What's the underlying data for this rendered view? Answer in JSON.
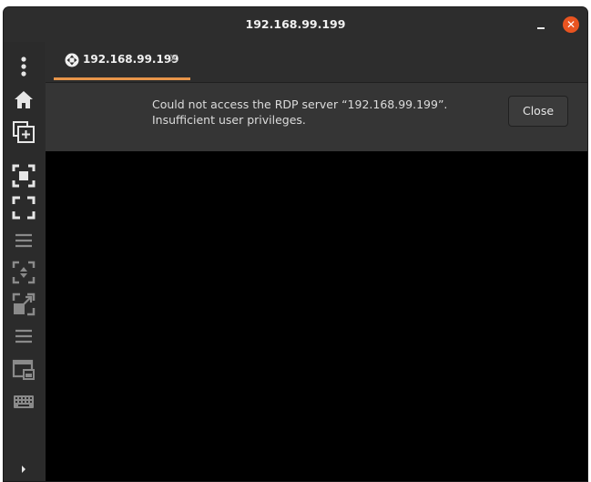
{
  "window": {
    "title": "192.168.99.199",
    "close_symbol": "✕"
  },
  "tab": {
    "label": "192.168.99.199",
    "close_symbol": "×",
    "icon": "remote-desktop-icon"
  },
  "infobar": {
    "line1": "Could not access the RDP server “192.168.99.199”.",
    "line2": "Insufficient user privileges.",
    "close_label": "Close"
  },
  "sidebar": {
    "icons": [
      "menu-dots-icon",
      "home-icon",
      "new-connection-icon",
      "fit-window-icon",
      "fullscreen-icon",
      "menu-lines-icon",
      "scale-icon",
      "dynamic-resolution-icon",
      "menu-lines-icon",
      "multi-monitor-icon",
      "keyboard-icon",
      "expand-icon"
    ]
  },
  "colors": {
    "accent": "#e95420",
    "tab_underline": "#e8954a",
    "panel": "#353535",
    "background": "#2c2c2c"
  }
}
